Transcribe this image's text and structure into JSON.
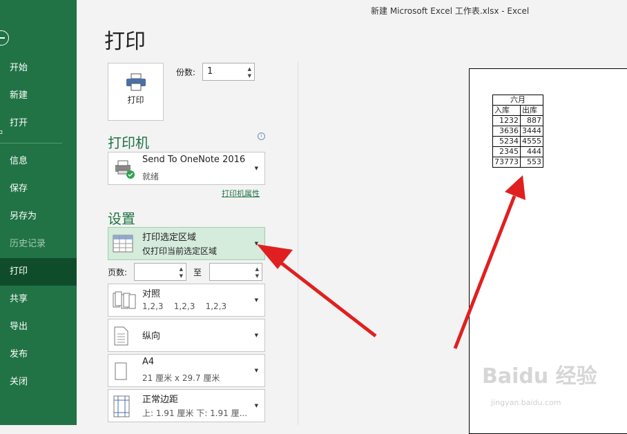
{
  "window": {
    "title": "新建 Microsoft Excel 工作表.xlsx  -  Excel"
  },
  "sidebar": {
    "items": [
      {
        "label": "开始",
        "icon": "home-icon"
      },
      {
        "label": "新建",
        "icon": "new-icon"
      },
      {
        "label": "打开",
        "icon": "open-icon"
      },
      {
        "label": "信息"
      },
      {
        "label": "保存"
      },
      {
        "label": "另存为"
      },
      {
        "label": "历史记录"
      },
      {
        "label": "打印"
      },
      {
        "label": "共享"
      },
      {
        "label": "导出"
      },
      {
        "label": "发布"
      },
      {
        "label": "关闭"
      }
    ],
    "active": "打印",
    "colors": {
      "background": "#217346",
      "active": "#0f4d2a"
    }
  },
  "print": {
    "page_title": "打印",
    "print_button_label": "打印",
    "copies_label": "份数:",
    "copies_value": "1",
    "printer_section": "打印机",
    "printer_name": "Send To OneNote 2016",
    "printer_status": "就绪",
    "printer_properties_link": "打印机属性",
    "settings_section": "设置",
    "selection_title": "打印选定区域",
    "selection_desc": "仅打印当前选定区域",
    "pages_label": "页数:",
    "to_label": "至",
    "collate_title": "对照",
    "collate_desc": "1,2,3    1,2,3    1,2,3",
    "orientation_title": "纵向",
    "paper_title": "A4",
    "paper_desc": "21 厘米 x 29.7 厘米",
    "margins_title": "正常边距",
    "margins_desc": "上: 1.91 厘米 下: 1.91 厘..."
  },
  "preview": {
    "header": "六月",
    "col1": "入库",
    "col2": "出库",
    "rows": [
      [
        "1232",
        "887"
      ],
      [
        "3636",
        "3444"
      ],
      [
        "5234",
        "4555"
      ],
      [
        "2345",
        "444"
      ],
      [
        "73773",
        "553"
      ]
    ]
  },
  "watermark": {
    "line1": "Baidu 经验",
    "line2": "jingyan.baidu.com"
  },
  "annotation_color": "#e02020"
}
